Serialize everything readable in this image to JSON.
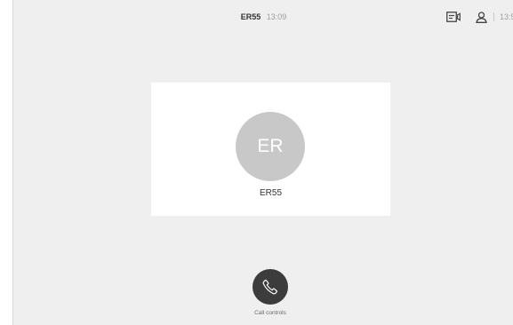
{
  "call": {
    "name": "ER55",
    "duration": "13:09"
  },
  "header": {
    "clock": "13:5",
    "self_view_icon": "self-view-icon",
    "participants_icon": "person-icon"
  },
  "participant": {
    "initials": "ER",
    "name": "ER55"
  },
  "controls": {
    "call_controls_label": "Call controls",
    "call_controls_icon": "phone-icon"
  },
  "colors": {
    "background": "#efefef",
    "card": "#ffffff",
    "avatar": "#c8c8c8",
    "button": "#3c3c3c"
  }
}
